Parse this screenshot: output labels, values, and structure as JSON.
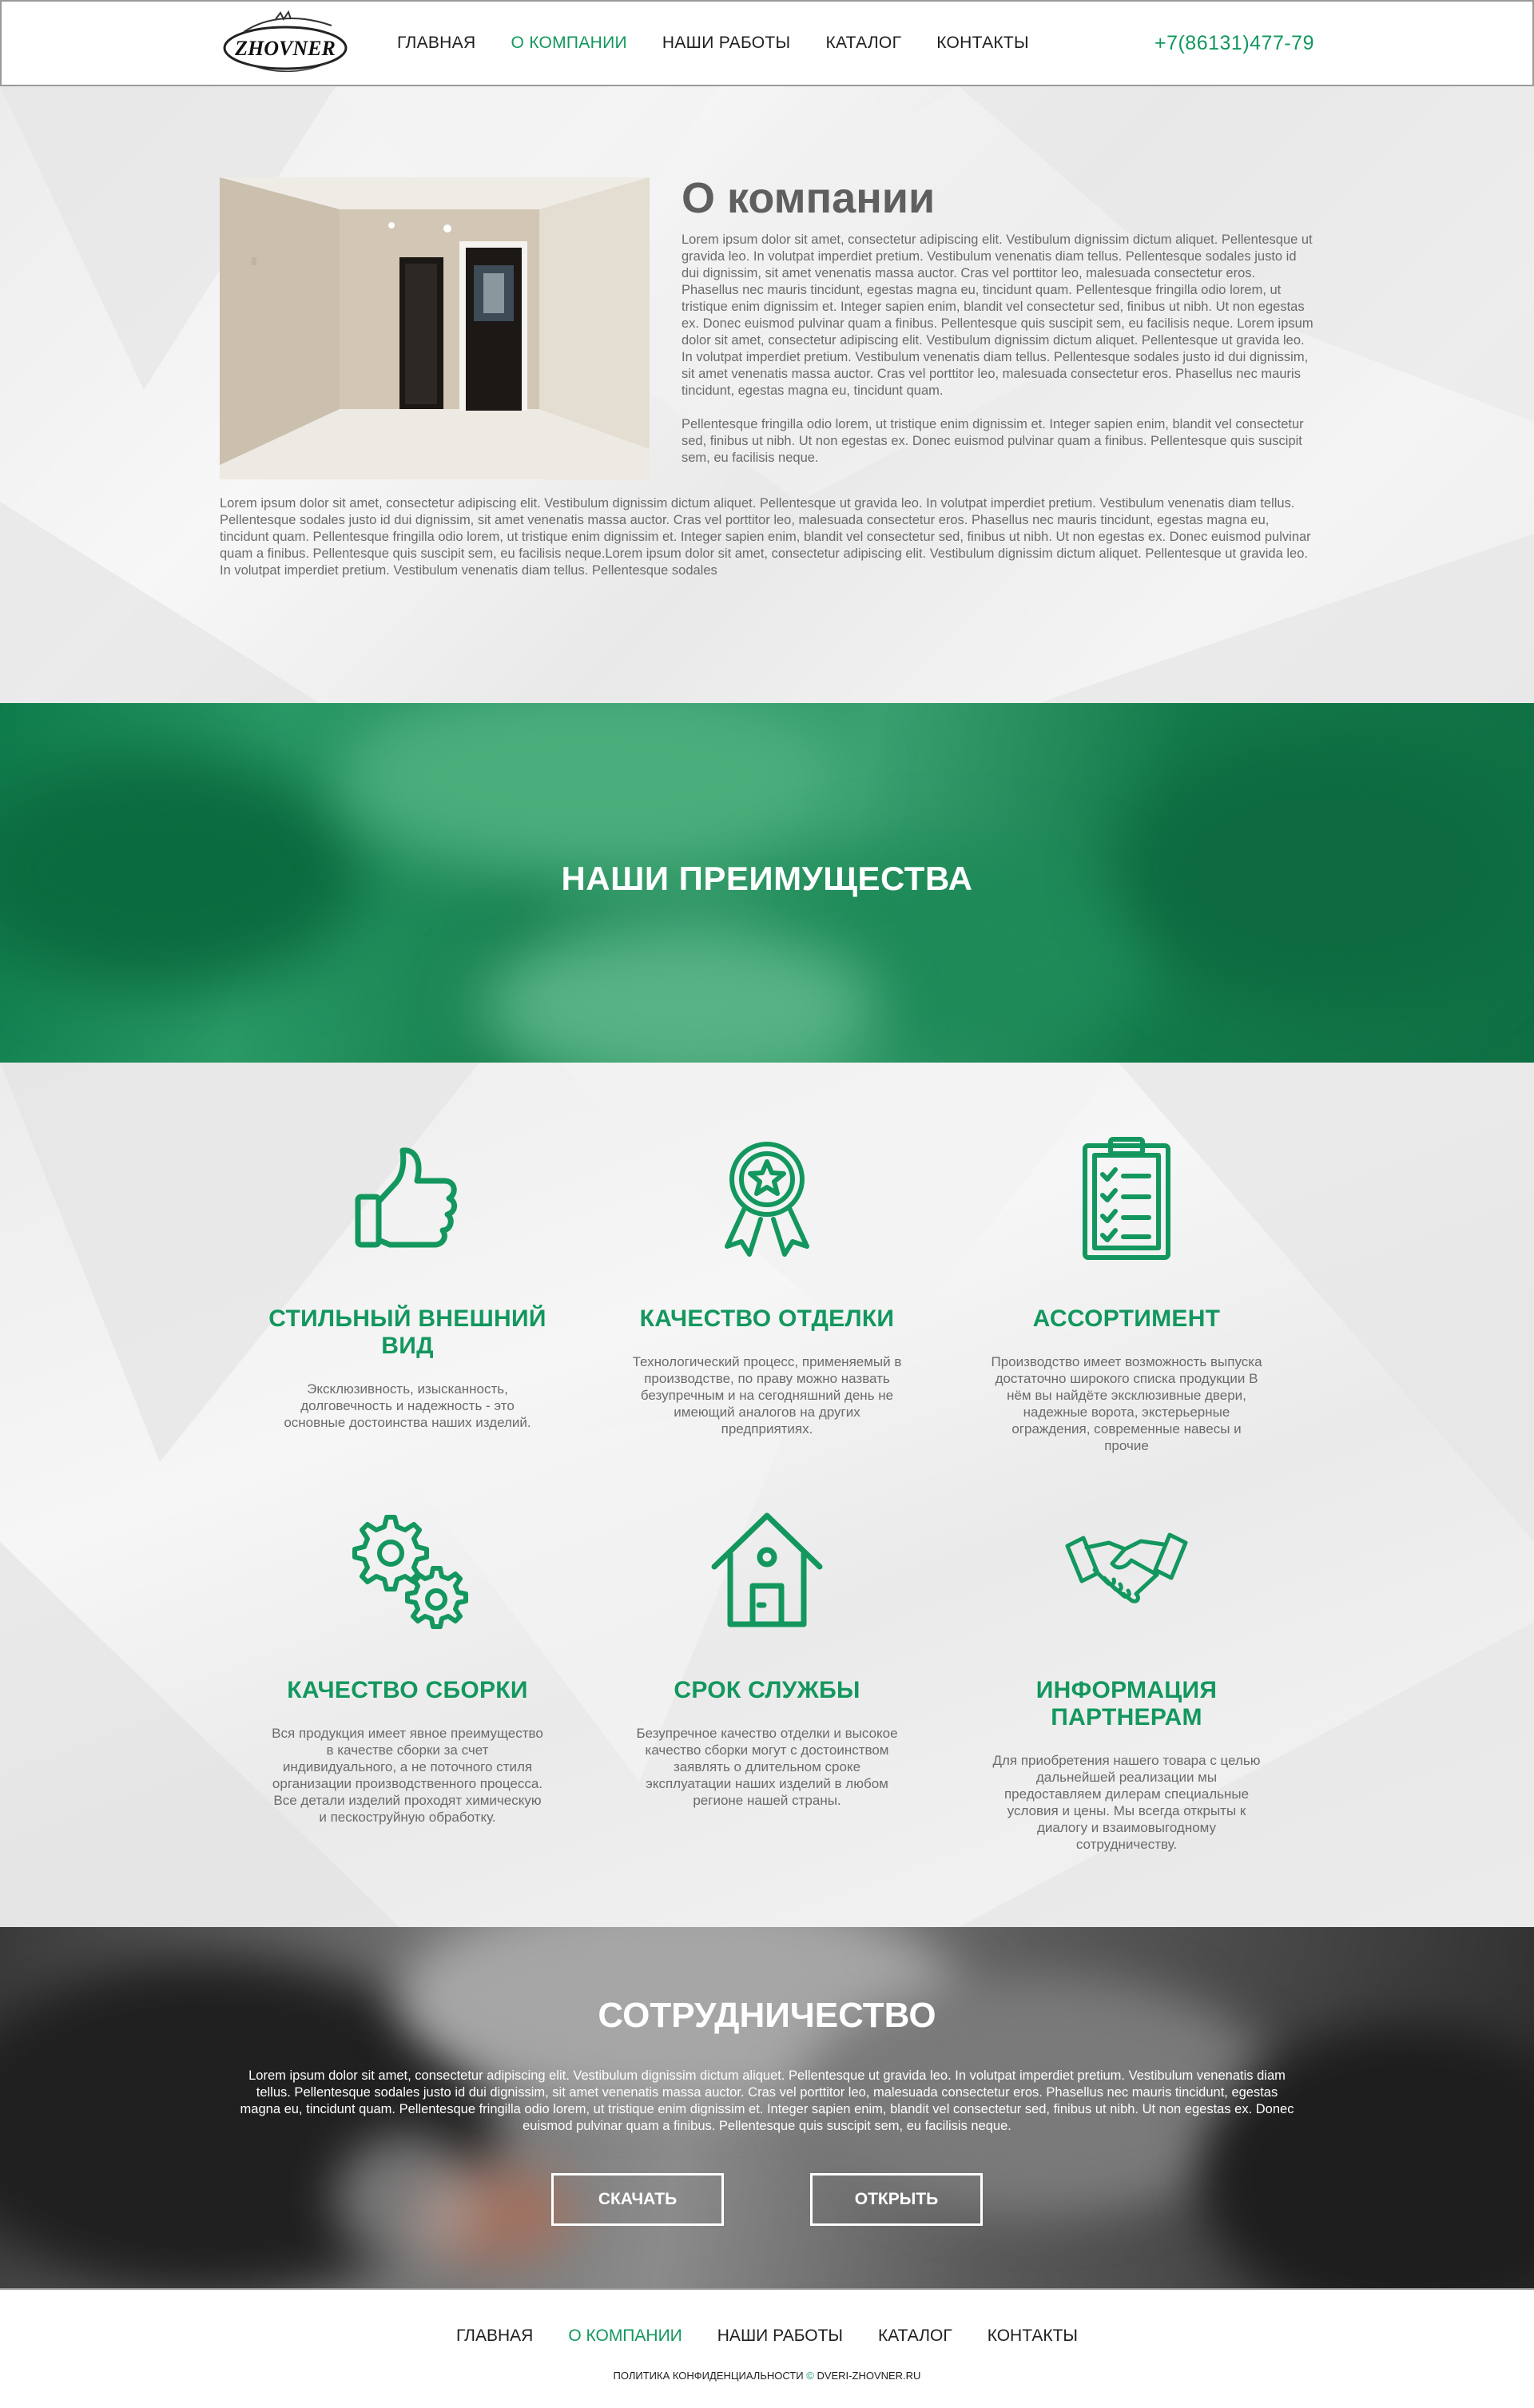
{
  "header": {
    "logo_text": "ZHOVNER",
    "nav": [
      {
        "label": "ГЛАВНАЯ"
      },
      {
        "label": "О КОМПАНИИ"
      },
      {
        "label": "НАШИ РАБОТЫ"
      },
      {
        "label": "КАТАЛОГ"
      },
      {
        "label": "КОНТАКТЫ"
      }
    ],
    "active_index": 1,
    "phone": "+7(86131)477-79"
  },
  "about": {
    "title": "О компании",
    "paragraph_1": "Lorem ipsum dolor sit amet, consectetur adipiscing elit. Vestibulum dignissim dictum aliquet. Pellentesque ut gravida leo. In volutpat imperdiet pretium. Vestibulum venenatis diam tellus. Pellentesque sodales justo id dui dignissim, sit amet venenatis massa auctor. Cras vel porttitor leo, malesuada consectetur eros. Phasellus nec mauris tincidunt, egestas magna eu, tincidunt quam. Pellentesque fringilla odio lorem, ut tristique enim dignissim et. Integer sapien enim, blandit vel consectetur sed, finibus ut nibh. Ut non egestas ex. Donec euismod pulvinar quam a finibus. Pellentesque quis suscipit sem, eu facilisis neque. Lorem ipsum dolor sit amet, consectetur adipiscing elit. Vestibulum dignissim dictum aliquet. Pellentesque ut gravida leo. In volutpat imperdiet pretium. Vestibulum venenatis diam tellus. Pellentesque sodales justo id dui dignissim, sit amet venenatis massa auctor. Cras vel porttitor leo, malesuada consectetur eros. Phasellus nec mauris tincidunt, egestas magna eu, tincidunt quam.",
    "paragraph_2": "Pellentesque fringilla odio lorem, ut tristique enim dignissim et. Integer sapien enim, blandit vel consectetur sed, finibus ut nibh. Ut non egestas ex. Donec euismod pulvinar quam a finibus. Pellentesque quis suscipit sem, eu facilisis neque.",
    "paragraph_full": "Lorem ipsum dolor sit amet, consectetur adipiscing elit. Vestibulum dignissim dictum aliquet. Pellentesque ut gravida leo. In volutpat imperdiet pretium. Vestibulum venenatis diam tellus. Pellentesque sodales justo id dui dignissim, sit amet venenatis massa auctor. Cras vel porttitor leo, malesuada consectetur eros. Phasellus nec mauris tincidunt, egestas magna eu, tincidunt quam. Pellentesque fringilla odio lorem, ut tristique enim dignissim et. Integer sapien enim, blandit vel consectetur sed, finibus ut nibh. Ut non egestas ex. Donec euismod pulvinar quam a finibus. Pellentesque quis suscipit sem, eu facilisis neque.Lorem ipsum dolor sit amet, consectetur adipiscing elit. Vestibulum dignissim dictum aliquet. Pellentesque ut gravida leo. In volutpat imperdiet pretium. Vestibulum venenatis diam tellus. Pellentesque sodales"
  },
  "advantages": {
    "title": "НАШИ ПРЕИМУЩЕСТВА",
    "items": [
      {
        "icon": "thumbs-up-icon",
        "title": "СТИЛЬНЫЙ ВНЕШНИЙ ВИД",
        "text": "Эксклюзивность, изысканность, долговечность и надежность - это основные достоинства наших изделий."
      },
      {
        "icon": "award-ribbon-icon",
        "title": "КАЧЕСТВО ОТДЕЛКИ",
        "text": "Технологический процесс, применяемый в производстве, по праву можно назвать безупречным и на сегодняшний день не имеющий аналогов на других предприятиях."
      },
      {
        "icon": "clipboard-checklist-icon",
        "title": "АССОРТИМЕНТ",
        "text": "Производство имеет возможность выпуска достаточно широкого списка продукции В нём вы найдёте эксклюзивные двери, надежные ворота, экстерьерные ограждения, современные навесы и прочие"
      },
      {
        "icon": "gears-icon",
        "title": "КАЧЕСТВО СБОРКИ",
        "text": "Вся продукция имеет явное преимущество в качестве сборки за счет индивидуального, а не поточного стиля организации производственного процесса. Все детали изделий проходят химическую и пескоструйную обработку."
      },
      {
        "icon": "house-icon",
        "title": "СРОК СЛУЖБЫ",
        "text": "Безупречное качество отделки и высокое качество сборки могут с достоинством заявлять о длительном сроке эксплуатации наших изделий в любом регионе нашей страны."
      },
      {
        "icon": "handshake-icon",
        "title": "ИНФОРМАЦИЯ ПАРТНЕРАМ",
        "text": "Для приобретения нашего товара с целью дальнейшей реализации мы предоставляем дилерам специальные условия и цены. Мы всегда открыты к диалогу и взаимовыгодному сотрудничеству."
      }
    ]
  },
  "cooperation": {
    "title": "СОТРУДНИЧЕСТВО",
    "text": "Lorem ipsum dolor sit amet, consectetur adipiscing elit. Vestibulum dignissim dictum aliquet. Pellentesque ut gravida leo. In volutpat imperdiet pretium. Vestibulum venenatis diam tellus. Pellentesque sodales justo id dui dignissim, sit amet venenatis massa auctor. Cras vel porttitor leo, malesuada consectetur eros. Phasellus nec mauris tincidunt, egestas magna eu, tincidunt quam. Pellentesque fringilla odio lorem, ut tristique enim dignissim et. Integer sapien enim, blandit vel consectetur sed, finibus ut nibh. Ut non egestas ex. Donec euismod pulvinar quam a finibus. Pellentesque quis suscipit sem, eu facilisis neque.",
    "download_label": "СКАЧАТЬ",
    "open_label": "ОТКРЫТЬ"
  },
  "footer": {
    "nav": [
      {
        "label": "ГЛАВНАЯ"
      },
      {
        "label": "О КОМПАНИИ"
      },
      {
        "label": "НАШИ РАБОТЫ"
      },
      {
        "label": "КАТАЛОГ"
      },
      {
        "label": "КОНТАКТЫ"
      }
    ],
    "privacy": "ПОЛИТИКА КОНФИДЕНЦИАЛЬНОСТИ",
    "copyright": "©",
    "site": "DVERI-ZHOVNER.RU"
  },
  "colors": {
    "accent": "#13975e",
    "text": "#1f1f1f",
    "muted": "#6b6b6b"
  }
}
